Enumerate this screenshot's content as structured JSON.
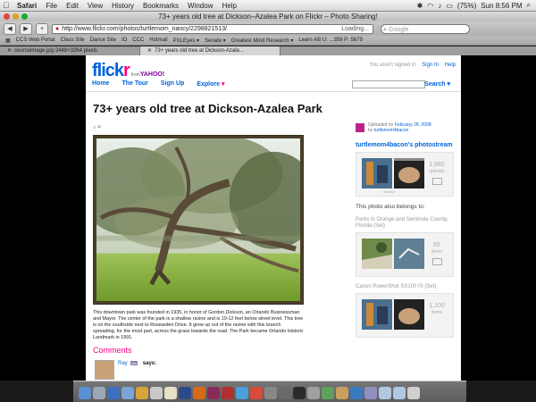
{
  "menubar": {
    "apple": "",
    "items": [
      "Safari",
      "File",
      "Edit",
      "View",
      "History",
      "Bookmarks",
      "Window",
      "Help"
    ],
    "battery": "(75%)",
    "clock": "Sun 8:56 PM"
  },
  "window": {
    "title": "73+ years old tree at Dickson–Azalea Park on Flickr – Photo Sharing!"
  },
  "toolbar": {
    "url": "http://www.flickr.com/photos/turtlemom_nancy/2298821513/",
    "loading": "Loading...",
    "search_placeholder": "Google"
  },
  "bookmarks": [
    "CCS Web Portal",
    "Class Site",
    "Dance Site",
    "IO",
    "CCC",
    "Hotmail",
    "PXLEyes ▾",
    "Senate ▾",
    "Greatest Mind Research ▾",
    "Learn AB U: ...359 P: 5679"
  ],
  "tabs": [
    {
      "label": "sourceimage.jpg 2448×3264 pixels"
    },
    {
      "label": "73+ years old tree at Dickson-Azale..."
    }
  ],
  "flickr": {
    "logo_fl": "flick",
    "logo_r": "r",
    "from": "from",
    "yahoo": "YAHOO!",
    "signed_out": "You aren't signed in",
    "sign_in": "Sign In",
    "help": "Help",
    "nav": [
      "Home",
      "The Tour",
      "Sign Up",
      "Explore"
    ],
    "search_label": "Search"
  },
  "photo": {
    "title": "73+ years old tree at Dickson-Azalea Park",
    "tools": "⌕ ✉",
    "description": "This downtown park was founded in 1935, in honor of Gordon Dickson, an Orlando Businessman and Mayor. The center of the park is a shallow ravine and is 10-12 feet below street level. This tree is on the southside next to Rosearden Drive. It grew up out of the ravine with this branch spreading, for the most part, across the grass towards the road. The Park became Orlando Historic Landmark in 1991."
  },
  "comments": {
    "heading": "Comments",
    "first": {
      "name": "Ray",
      "pro": "pro",
      "says": "says:"
    }
  },
  "sidebar": {
    "uploaded_prefix": "Uploaded on",
    "uploaded_date": "February 28, 2008",
    "by": "by",
    "owner": "turtlemom4bacon",
    "stream_title": "turtlemom4bacon's photostream",
    "stream_count": "1,682",
    "stream_unit": "uploads",
    "browse": "browse",
    "belongs": "This photo also belongs to:",
    "set1_title": "Parks in Orange and Seminole County, Florida (Set)",
    "set1_count": "65",
    "set1_unit": "items",
    "set2_title": "Canon PowerShot SX100 IS (Set)",
    "set2_count": "1,100",
    "set2_unit": "items"
  }
}
